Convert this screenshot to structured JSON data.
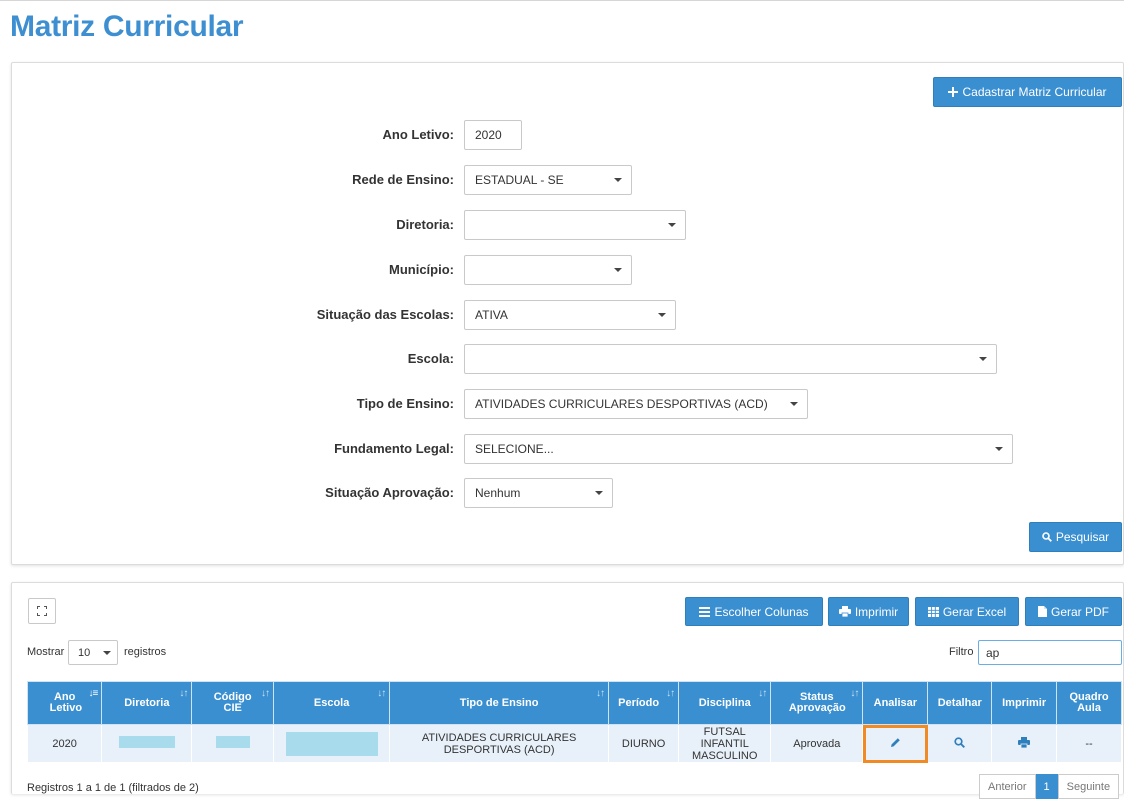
{
  "page": {
    "title": "Matriz Curricular"
  },
  "actions": {
    "cadastrar": "Cadastrar Matriz Curricular",
    "pesquisar": "Pesquisar"
  },
  "filters": {
    "ano_letivo": {
      "label": "Ano Letivo:",
      "value": "2020"
    },
    "rede_ensino": {
      "label": "Rede de Ensino:",
      "value": "ESTADUAL - SE"
    },
    "diretoria": {
      "label": "Diretoria:",
      "value": ""
    },
    "municipio": {
      "label": "Município:",
      "value": ""
    },
    "situacao_escolas": {
      "label": "Situação das Escolas:",
      "value": "ATIVA"
    },
    "escola": {
      "label": "Escola:",
      "value": ""
    },
    "tipo_ensino": {
      "label": "Tipo de Ensino:",
      "value": "ATIVIDADES CURRICULARES DESPORTIVAS (ACD)"
    },
    "fundamento_legal": {
      "label": "Fundamento Legal:",
      "value": "SELECIONE..."
    },
    "situacao_aprovacao": {
      "label": "Situação Aprovação:",
      "value": "Nenhum"
    }
  },
  "toolbar": {
    "escolher_colunas": "Escolher Colunas",
    "imprimir": "Imprimir",
    "gerar_excel": "Gerar Excel",
    "gerar_pdf": "Gerar PDF"
  },
  "list_controls": {
    "mostrar": "Mostrar",
    "page_size": "10",
    "registros": "registros",
    "filtro_label": "Filtro",
    "filtro_value": "ap"
  },
  "table": {
    "headers": {
      "ano_letivo": "Ano Letivo",
      "diretoria": "Diretoria",
      "codigo_cie": "Código CIE",
      "escola": "Escola",
      "tipo_ensino": "Tipo de Ensino",
      "periodo": "Período",
      "disciplina": "Disciplina",
      "status_aprovacao": "Status Aprovação",
      "analisar": "Analisar",
      "detalhar": "Detalhar",
      "imprimir": "Imprimir",
      "quadro_aula": "Quadro Aula"
    },
    "rows": [
      {
        "ano_letivo": "2020",
        "tipo_ensino": "ATIVIDADES CURRICULARES DESPORTIVAS (ACD)",
        "periodo": "DIURNO",
        "disciplina": "FUTSAL INFANTIL MASCULINO",
        "status_aprovacao": "Aprovada",
        "quadro_aula": "--"
      }
    ]
  },
  "footer": {
    "info": "Registros 1 a 1 de 1 (filtrados de 2)",
    "anterior": "Anterior",
    "current_page": "1",
    "seguinte": "Seguinte"
  },
  "colors": {
    "accent": "#3a8fd1",
    "title": "#3d8fd1",
    "highlight": "#f08a24",
    "row_bg": "#e8f1fa"
  },
  "icons": [
    "plus-icon",
    "search-icon",
    "expand-icon",
    "list-icon",
    "print-icon",
    "grid-icon",
    "file-icon",
    "pencil-icon",
    "sort-icon"
  ]
}
